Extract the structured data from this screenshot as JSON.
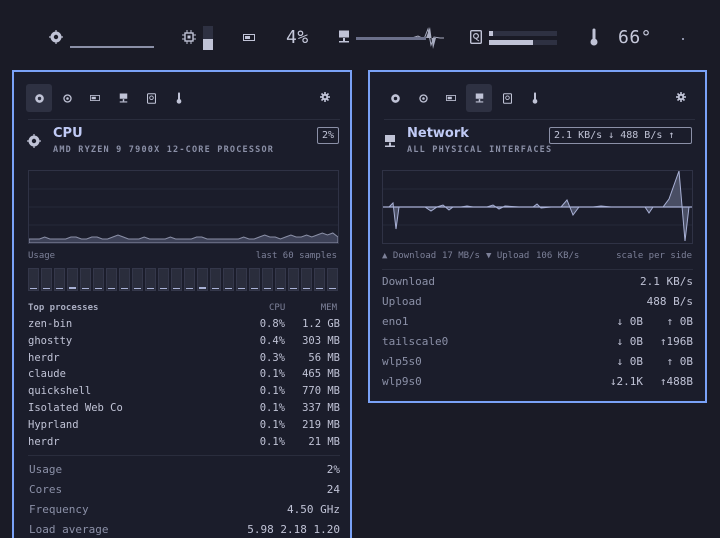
{
  "topbar": {
    "mem_label": "4%",
    "temp_label": "66°",
    "icons": [
      "chip-icon",
      "cpu-icon",
      "memory-icon",
      "network-icon",
      "disk-icon",
      "thermometer-icon"
    ],
    "disk_fill_fraction": 0.65
  },
  "cpu": {
    "tabs": [
      "chip-icon",
      "cpu-icon",
      "memory-icon",
      "network-icon",
      "disk-icon",
      "thermometer-icon"
    ],
    "active_tab": 0,
    "title": "CPU",
    "subtitle": "AMD RYZEN 9 7900X 12-CORE PROCESSOR",
    "badge": "2%",
    "graph_left_label": "Usage",
    "graph_right_label": "last 60 samples",
    "core_usage": [
      0.04,
      0.02,
      0.03,
      0.08,
      0.03,
      0.02,
      0.02,
      0.03,
      0.02,
      0.02,
      0.02,
      0.03,
      0.02,
      0.1,
      0.03,
      0.02,
      0.02,
      0.05,
      0.02,
      0.02,
      0.03,
      0.02,
      0.02,
      0.02
    ],
    "processes_header": {
      "name": "Top processes",
      "cpu": "CPU",
      "mem": "MEM"
    },
    "processes": [
      {
        "name": "zen-bin",
        "cpu": "0.8%",
        "mem": "1.2 GB"
      },
      {
        "name": "ghostty",
        "cpu": "0.4%",
        "mem": "303 MB"
      },
      {
        "name": "herdr",
        "cpu": "0.3%",
        "mem": "56 MB"
      },
      {
        "name": "claude",
        "cpu": "0.1%",
        "mem": "465 MB"
      },
      {
        "name": "quickshell",
        "cpu": "0.1%",
        "mem": "770 MB"
      },
      {
        "name": "Isolated Web Co",
        "cpu": "0.1%",
        "mem": "337 MB"
      },
      {
        "name": "Hyprland",
        "cpu": "0.1%",
        "mem": "219 MB"
      },
      {
        "name": "herdr",
        "cpu": "0.1%",
        "mem": "21 MB"
      }
    ],
    "stats": [
      {
        "key": "Usage",
        "value": "2%"
      },
      {
        "key": "Cores",
        "value": "24"
      },
      {
        "key": "Frequency",
        "value": "4.50 GHz"
      },
      {
        "key": "Load average",
        "value": "5.98  2.18  1.20"
      }
    ]
  },
  "network": {
    "tabs": [
      "chip-icon",
      "cpu-icon",
      "memory-icon",
      "network-icon",
      "disk-icon",
      "thermometer-icon"
    ],
    "active_tab": 3,
    "title": "Network",
    "subtitle": "ALL PHYSICAL INTERFACES",
    "badge": "2.1 KB/s ↓  488 B/s ↑",
    "legend_download": "▲ Download",
    "legend_download_scale": "17 MB/s",
    "legend_upload": "▼ Upload",
    "legend_upload_scale": "106 KB/s",
    "legend_right": "scale per side",
    "rows": [
      {
        "key": "Download",
        "value": "2.1 KB/s"
      },
      {
        "key": "Upload",
        "value": "488 B/s"
      }
    ],
    "interfaces": [
      {
        "name": "eno1",
        "down": "↓  0B",
        "up": "↑  0B"
      },
      {
        "name": "tailscale0",
        "down": "↓  0B",
        "up": "↑196B"
      },
      {
        "name": "wlp5s0",
        "down": "↓  0B",
        "up": "↑  0B"
      },
      {
        "name": "wlp9s0",
        "down": "↓2.1K",
        "up": "↑488B"
      }
    ]
  },
  "colors": {
    "accent": "#7aa2f7",
    "background": "#1a1b26",
    "graph_line": "#a9b1d6"
  }
}
